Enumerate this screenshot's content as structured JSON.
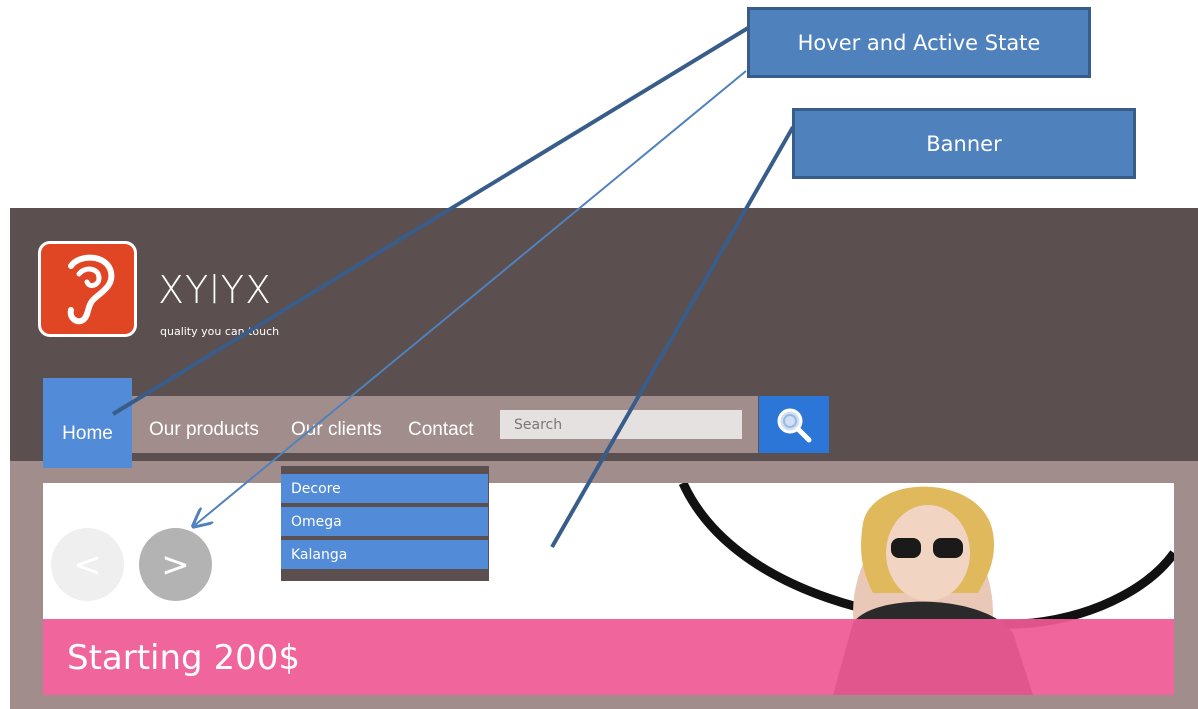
{
  "annotations": {
    "hover_label": "Hover and Active State",
    "banner_label": "Banner"
  },
  "site": {
    "logo": {
      "icon": "ear-logo-icon",
      "brand": "XYlYX",
      "tagline": "quality you can touch"
    },
    "nav": {
      "home": "Home",
      "products": "Our products",
      "clients": "Our clients",
      "contact": "Contact"
    },
    "search": {
      "placeholder": "Search",
      "button_icon": "magnifier-icon"
    },
    "dropdown": [
      "Decore",
      "Omega",
      "Kalanga"
    ],
    "banner": {
      "prev": "<",
      "next": ">",
      "caption": "Starting 200$"
    }
  },
  "colors": {
    "header": "#5b4f4f",
    "body": "#a18e8c",
    "active": "#528bd8",
    "search_btn": "#2b76d6",
    "banner_strip": "#ef5a95",
    "logo": "#e04524",
    "callout": "#4f81bd"
  }
}
